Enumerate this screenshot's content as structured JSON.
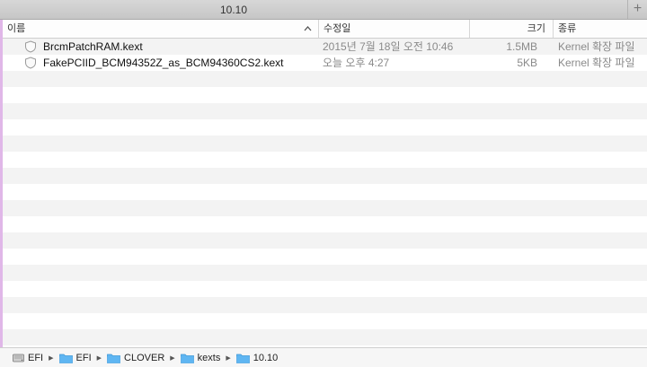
{
  "window": {
    "tab_title": "10.10",
    "new_tab_label": "+"
  },
  "columns": {
    "name": "이름",
    "date": "수정일",
    "size": "크기",
    "kind": "종류"
  },
  "files": [
    {
      "name": "BrcmPatchRAM.kext",
      "date": "2015년 7월 18일 오전 10:46",
      "size": "1.5MB",
      "kind": "Kernel 확장 파일",
      "icon": "kext-icon"
    },
    {
      "name": "FakePCIID_BCM94352Z_as_BCM94360CS2.kext",
      "date": "오늘 오후 4:27",
      "size": "5KB",
      "kind": "Kernel 확장 파일",
      "icon": "kext-icon"
    }
  ],
  "path": [
    {
      "label": "EFI",
      "icon": "drive-icon"
    },
    {
      "label": "EFI",
      "icon": "folder-icon"
    },
    {
      "label": "CLOVER",
      "icon": "folder-icon"
    },
    {
      "label": "kexts",
      "icon": "folder-icon"
    },
    {
      "label": "10.10",
      "icon": "folder-icon"
    }
  ],
  "colors": {
    "folder": "#5fb6f2",
    "stripe": "#f3f3f3",
    "accent_edge": "#e0b7e8"
  }
}
